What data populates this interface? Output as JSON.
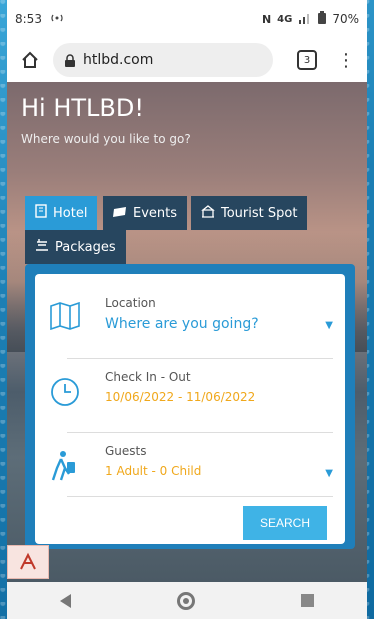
{
  "status": {
    "time": "8:53",
    "network": "4G",
    "battery": "70%"
  },
  "browser": {
    "url": "htlbd.com",
    "tab_count": "3",
    "menu": "⋮"
  },
  "hero": {
    "title": "Hi HTLBD!",
    "subtitle": "Where would you like to go?"
  },
  "tabs": [
    {
      "label": "Hotel",
      "active": true
    },
    {
      "label": "Events",
      "active": false
    },
    {
      "label": "Tourist Spot",
      "active": false
    },
    {
      "label": "Packages",
      "active": false
    }
  ],
  "search": {
    "location": {
      "label": "Location",
      "value": "Where are you going?"
    },
    "dates": {
      "label": "Check In - Out",
      "value": "10/06/2022 - 11/06/2022"
    },
    "guests": {
      "label": "Guests",
      "value": "1 Adult - 0 Child"
    },
    "button": "SEARCH"
  },
  "colors": {
    "accent": "#2a9bd7",
    "date_text": "#f0a81c",
    "card_frame": "#1f7fba"
  }
}
